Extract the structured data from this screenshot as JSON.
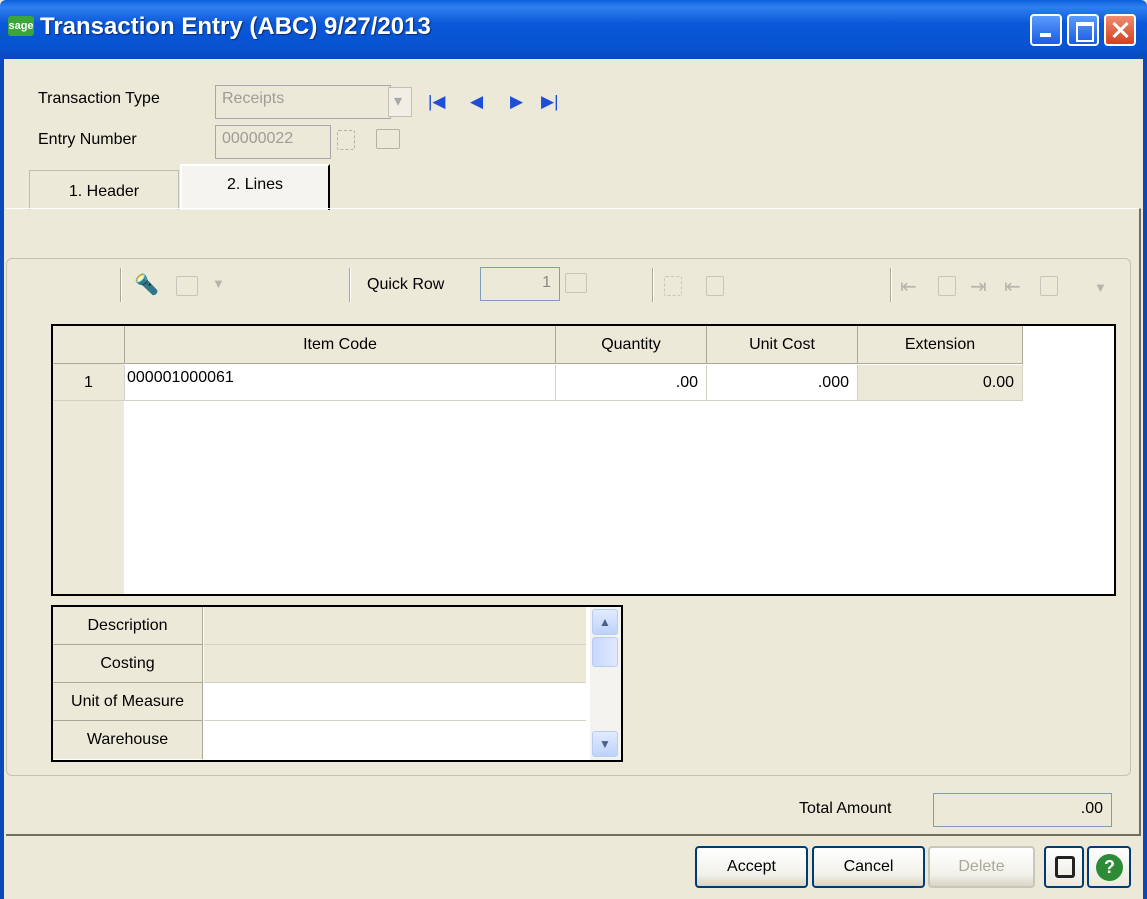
{
  "window": {
    "logo_text": "sage",
    "title": "Transaction Entry (ABC) 9/27/2013"
  },
  "form": {
    "transaction_type_label": "Transaction Type",
    "transaction_type_value": "Receipts",
    "entry_number_label": "Entry Number",
    "entry_number_value": "00000022"
  },
  "tabs": [
    {
      "label": "1. Header",
      "active": false
    },
    {
      "label": "2. Lines",
      "active": true
    }
  ],
  "toolbar": {
    "quick_row_label": "Quick Row",
    "quick_row_value": "1"
  },
  "grid": {
    "columns": [
      "Item Code",
      "Quantity",
      "Unit Cost",
      "Extension"
    ],
    "rows": [
      {
        "row_num": "1",
        "item_code": "000001000061",
        "quantity": ".00",
        "unit_cost": ".000",
        "extension": "0.00"
      }
    ]
  },
  "properties": [
    {
      "label": "Description",
      "value": ""
    },
    {
      "label": "Costing",
      "value": ""
    },
    {
      "label": "Unit of Measure",
      "value": ""
    },
    {
      "label": "Warehouse",
      "value": ""
    }
  ],
  "totals": {
    "label": "Total Amount",
    "value": ".00"
  },
  "buttons": {
    "accept": "Accept",
    "cancel": "Cancel",
    "delete": "Delete"
  },
  "colors": {
    "title_bar": "#0753d2",
    "window_bg": "#ece9d8",
    "nav_arrows": "#1e4fd8"
  }
}
